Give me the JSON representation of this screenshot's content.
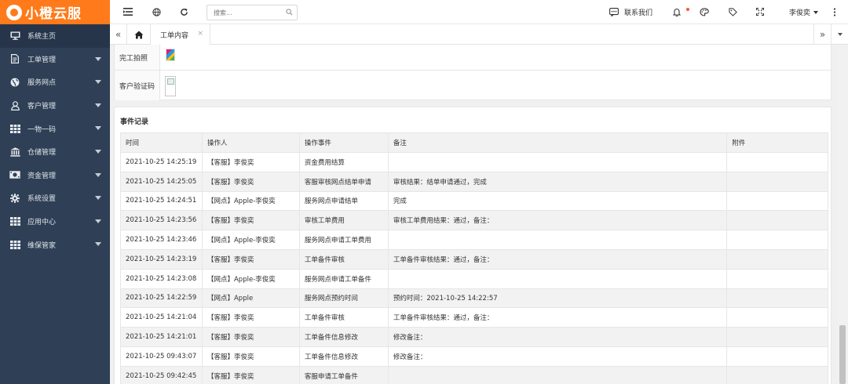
{
  "app": {
    "logo": "小橙云服"
  },
  "sidebar": {
    "items": [
      {
        "label": "系统主页",
        "icon": "monitor-icon",
        "arrow": false,
        "active": true
      },
      {
        "label": "工单管理",
        "icon": "document-icon",
        "arrow": true
      },
      {
        "label": "服务网点",
        "icon": "globe-icon",
        "arrow": true
      },
      {
        "label": "客户管理",
        "icon": "user-icon",
        "arrow": true
      },
      {
        "label": "一物一码",
        "icon": "grid-icon",
        "arrow": true
      },
      {
        "label": "仓储管理",
        "icon": "bank-icon",
        "arrow": true
      },
      {
        "label": "资金管理",
        "icon": "money-icon",
        "arrow": true
      },
      {
        "label": "系统设置",
        "icon": "gear-icon",
        "arrow": true
      },
      {
        "label": "应用中心",
        "icon": "grid-icon",
        "arrow": true
      },
      {
        "label": "维保管家",
        "icon": "grid-icon",
        "arrow": true
      }
    ]
  },
  "header": {
    "search_placeholder": "搜索...",
    "contact_label": "联系我们",
    "user_name": "李俊奕"
  },
  "tabs": {
    "current": "工单内容",
    "close": "×"
  },
  "photos": {
    "rows": [
      {
        "label": "完工拍照"
      },
      {
        "label": "客户验证码"
      }
    ]
  },
  "events": {
    "title": "事件记录",
    "columns": [
      "时间",
      "操作人",
      "操作事件",
      "备注",
      "附件"
    ],
    "rows": [
      [
        "2021-10-25 14:25:19",
        "【客服】李俊奕",
        "资金费用结算",
        "",
        ""
      ],
      [
        "2021-10-25 14:25:05",
        "【客服】李俊奕",
        "客服审核网点结单申请",
        "审核结果：结单申请通过，完成",
        ""
      ],
      [
        "2021-10-25 14:24:51",
        "【网点】Apple-李俊奕",
        "服务网点申请结单",
        "完成",
        ""
      ],
      [
        "2021-10-25 14:23:56",
        "【客服】李俊奕",
        "审核工单费用",
        "审核工单费用结果：通过，备注：",
        ""
      ],
      [
        "2021-10-25 14:23:46",
        "【网点】Apple-李俊奕",
        "服务网点申请工单费用",
        "",
        ""
      ],
      [
        "2021-10-25 14:23:19",
        "【客服】李俊奕",
        "工单备件审核",
        "工单备件审核结果：通过，备注：",
        ""
      ],
      [
        "2021-10-25 14:23:08",
        "【网点】Apple-李俊奕",
        "服务网点申请工单备件",
        "",
        ""
      ],
      [
        "2021-10-25 14:22:59",
        "【网点】Apple",
        "服务网点预约时间",
        "预约时间：2021-10-25 14:22:57",
        ""
      ],
      [
        "2021-10-25 14:21:04",
        "【客服】李俊奕",
        "工单备件审核",
        "工单备件审核结果：通过，备注：",
        ""
      ],
      [
        "2021-10-25 14:21:01",
        "【客服】李俊奕",
        "工单备件信息修改",
        "修改备注：",
        ""
      ],
      [
        "2021-10-25 09:43:07",
        "【客服】李俊奕",
        "工单备件信息修改",
        "修改备注：",
        ""
      ],
      [
        "2021-10-25 09:42:45",
        "【客服】李俊奕",
        "客服申请工单备件",
        "",
        ""
      ]
    ]
  },
  "colors": {
    "brand": "#ff7a1a",
    "sidebar": "#2f4056",
    "notify_dot": "#ff5722"
  }
}
